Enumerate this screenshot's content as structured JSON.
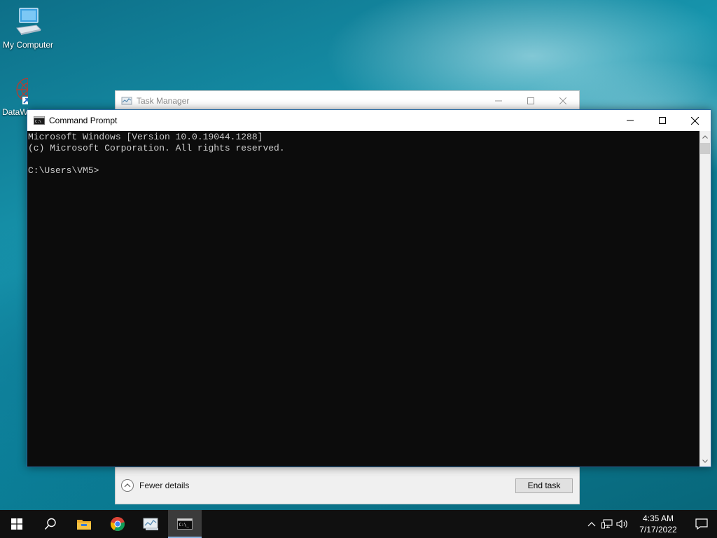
{
  "desktop": {
    "icons": [
      {
        "label": "My Computer"
      },
      {
        "label": "DataW"
      }
    ]
  },
  "task_manager": {
    "title": "Task Manager",
    "fewer_details_label": "Fewer details",
    "end_task_label": "End task"
  },
  "command_prompt": {
    "title": "Command Prompt",
    "lines": [
      "Microsoft Windows [Version 10.0.19044.1288]",
      "(c) Microsoft Corporation. All rights reserved.",
      "",
      "C:\\Users\\VM5>"
    ]
  },
  "taskbar": {
    "apps": [
      "start-icon",
      "search-icon",
      "file-explorer-icon",
      "chrome-icon",
      "task-manager-icon",
      "command-prompt-icon"
    ],
    "active_app": "command-prompt-icon",
    "clock": {
      "time": "4:35 AM",
      "date": "7/17/2022"
    }
  },
  "colors": {
    "console_bg": "#0c0c0c",
    "console_text": "#cccccc",
    "taskbar_bg": "#101010"
  }
}
